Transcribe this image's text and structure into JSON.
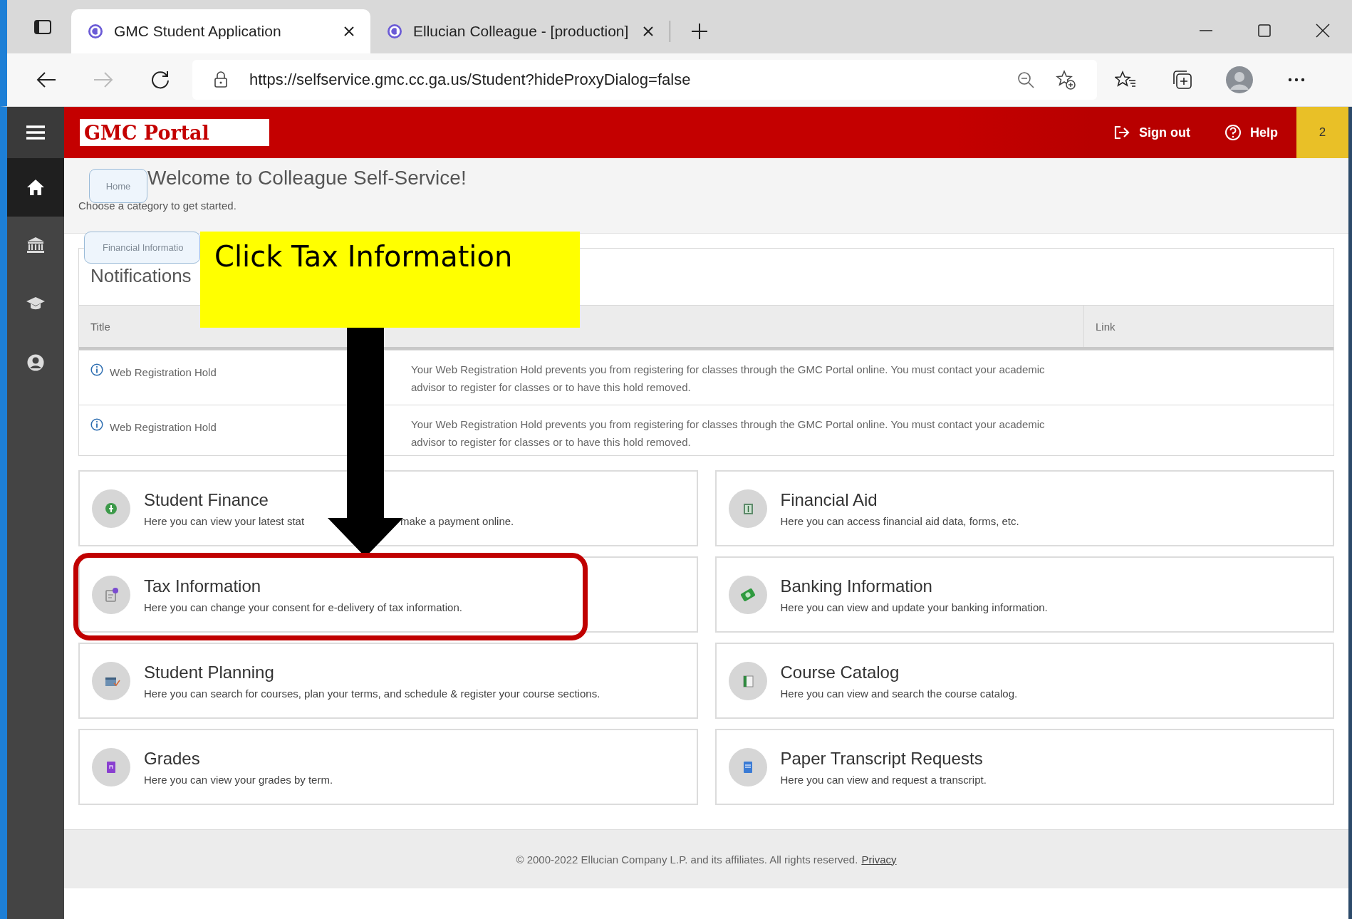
{
  "browser": {
    "tabs": [
      {
        "title": "GMC Student Application",
        "selected": true
      },
      {
        "title": "Ellucian Colleague - [production]",
        "selected": false
      }
    ],
    "url": "https://selfservice.gmc.cc.ga.us/Student?hideProxyDialog=false"
  },
  "header": {
    "logo": "GMC Portal",
    "sign_out": "Sign out",
    "help": "Help",
    "badge": "2"
  },
  "sidebar": {
    "items": [
      {
        "kind": "home",
        "selected": true
      },
      {
        "kind": "bank",
        "selected": false
      },
      {
        "kind": "cap",
        "selected": false
      },
      {
        "kind": "user",
        "selected": false
      }
    ]
  },
  "page": {
    "heading": "Welcome to Colleague Self-Service!",
    "subheading": "Choose a category to get started."
  },
  "breadcrumbs": [
    {
      "label": "Home"
    },
    {
      "label": "Financial Informatio"
    }
  ],
  "notifications": {
    "title": "Notifications",
    "columns": {
      "title": "Title",
      "link": "Link"
    },
    "rows": [
      {
        "title": "Web Registration Hold",
        "details": "Your Web Registration Hold prevents you from registering for classes through the GMC Portal online. You must contact your academic advisor to register for classes or to have this hold removed."
      },
      {
        "title": "Web Registration Hold",
        "details": "Your Web Registration Hold prevents you from registering for classes through the GMC Portal online. You must contact your academic advisor to register for classes or to have this hold removed."
      }
    ]
  },
  "cards": [
    {
      "kind": "finance",
      "title": "Student Finance",
      "description_parts": [
        "Here you can view your latest stat",
        "make a payment online."
      ],
      "highlighted": false
    },
    {
      "kind": "aid",
      "title": "Financial Aid",
      "description": "Here you can access financial aid data, forms, etc.",
      "highlighted": false
    },
    {
      "kind": "tax",
      "title": "Tax Information",
      "description": "Here you can change your consent for e-delivery of tax information.",
      "highlighted": true
    },
    {
      "kind": "banking",
      "title": "Banking Information",
      "description": "Here you can view and update your banking information.",
      "highlighted": false
    },
    {
      "kind": "planning",
      "title": "Student Planning",
      "description": "Here you can search for courses, plan your terms, and schedule & register your course sections.",
      "highlighted": false
    },
    {
      "kind": "catalog",
      "title": "Course Catalog",
      "description": "Here you can view and search the course catalog.",
      "highlighted": false
    },
    {
      "kind": "grades",
      "title": "Grades",
      "description": "Here you can view your grades by term.",
      "highlighted": false
    },
    {
      "kind": "transcript",
      "title": "Paper Transcript Requests",
      "description": "Here you can view and request a transcript.",
      "highlighted": false
    }
  ],
  "footer": {
    "copyright": "© 2000-2022 Ellucian Company L.P. and its affiliates. All rights reserved.",
    "link": "Privacy"
  },
  "annotation": {
    "callout": "Click Tax Information"
  }
}
